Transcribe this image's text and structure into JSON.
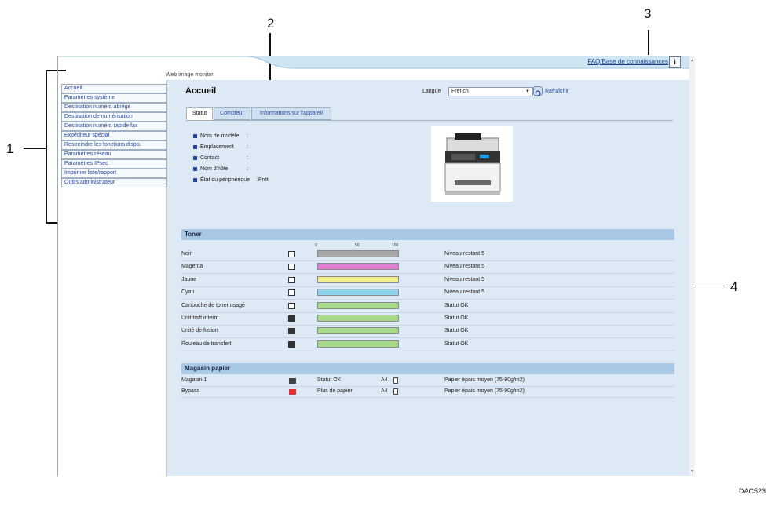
{
  "callouts": [
    "1",
    "2",
    "3",
    "4"
  ],
  "figure_code": "DAC523",
  "header": {
    "faq_link": "FAQ/Base de connaissances",
    "info_icon_label": "i",
    "app_name": "Web image monitor"
  },
  "sidebar": {
    "items": [
      {
        "label": "Accueil"
      },
      {
        "label": "Paramètres système"
      },
      {
        "label": "Destination numéro abrégé"
      },
      {
        "label": "Destination de numérisation"
      },
      {
        "label": "Destination numéro rapide fax"
      },
      {
        "label": "Expéditeur spécial"
      },
      {
        "label": "Restreindre les fonctions dispo."
      },
      {
        "label": "Paramètres réseau"
      },
      {
        "label": "Paramètres IPsec"
      },
      {
        "label": "Imprimer liste/rapport"
      },
      {
        "label": "Outils administrateur"
      }
    ]
  },
  "main": {
    "title": "Accueil",
    "language_label": "Langue",
    "language_value": "French",
    "refresh_label": "Rafraîchir",
    "tabs": [
      {
        "label": "Statut",
        "active": true
      },
      {
        "label": "Compteur",
        "active": false
      },
      {
        "label": "Informations sur l'appareil",
        "active": false
      }
    ],
    "device_info": [
      {
        "label": "Nom de modèle",
        "value": ":"
      },
      {
        "label": "Emplacement",
        "value": ":"
      },
      {
        "label": "Contact",
        "value": ":"
      },
      {
        "label": "Nom d'hôte",
        "value": ":"
      },
      {
        "label": "État du périphérique",
        "value": ":Prêt"
      }
    ],
    "toner": {
      "heading": "Toner",
      "scale": [
        "0",
        "50",
        "100"
      ],
      "items": [
        {
          "name": "Noir",
          "status": "Niveau restant 5",
          "level": 1.0,
          "color": "#a8a8a8",
          "icon": "toner-cartridge-icon"
        },
        {
          "name": "Magenta",
          "status": "Niveau restant 5",
          "level": 1.0,
          "color": "#e27fd0",
          "icon": "toner-cartridge-icon"
        },
        {
          "name": "Jaune",
          "status": "Niveau restant 5",
          "level": 1.0,
          "color": "#f4f08a",
          "icon": "toner-cartridge-icon"
        },
        {
          "name": "Cyan",
          "status": "Niveau restant 5",
          "level": 1.0,
          "color": "#8fd4ec",
          "icon": "toner-cartridge-icon"
        },
        {
          "name": "Cartouche de toner usagé",
          "status": "Statut OK",
          "level": 1.0,
          "color": "#a6d98a",
          "icon": "waste-toner-icon"
        },
        {
          "name": "Unit.trsft interm",
          "status": "Statut OK",
          "level": 1.0,
          "color": "#a6d98a",
          "icon": "unit-icon"
        },
        {
          "name": "Unité de fusion",
          "status": "Statut OK",
          "level": 1.0,
          "color": "#a6d98a",
          "icon": "unit-icon"
        },
        {
          "name": "Rouleau de transfert",
          "status": "Statut OK",
          "level": 1.0,
          "color": "#a6d98a",
          "icon": "unit-icon"
        }
      ]
    },
    "paper_tray": {
      "heading": "Magasin papier",
      "items": [
        {
          "name": "Magasin 1",
          "status": "Statut OK",
          "size": "A4",
          "paper": "Papier épais moyen (75-90g/m2)",
          "icon_color": "#444444"
        },
        {
          "name": "Bypass",
          "status": "Plus de papier",
          "size": "A4",
          "paper": "Papier épais moyen (75-90g/m2)",
          "icon_color": "#e03030"
        }
      ]
    }
  },
  "colors": {
    "banner": "#cfe6f2",
    "main_bg": "#dde9f4",
    "section_bar": "#a9c8e6",
    "link": "#2a4aa0"
  }
}
